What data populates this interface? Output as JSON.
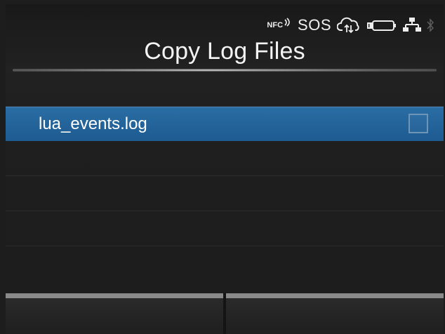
{
  "status_bar": {
    "nfc_label": "NFC",
    "sos_label": "SOS",
    "icons": [
      "nfc-icon",
      "cloud-sync-icon",
      "battery-icon",
      "network-icon",
      "bluetooth-icon"
    ]
  },
  "header": {
    "title": "Copy Log Files"
  },
  "files": [
    {
      "name": "lua_events.log",
      "selected": false,
      "highlighted": true
    }
  ],
  "softkeys": {
    "left_label": "",
    "right_label": ""
  },
  "colors": {
    "background": "#1d1d1d",
    "highlight": "#2266a0",
    "softkey_bar": "#8a8a8a",
    "text": "#f2f2f2"
  }
}
